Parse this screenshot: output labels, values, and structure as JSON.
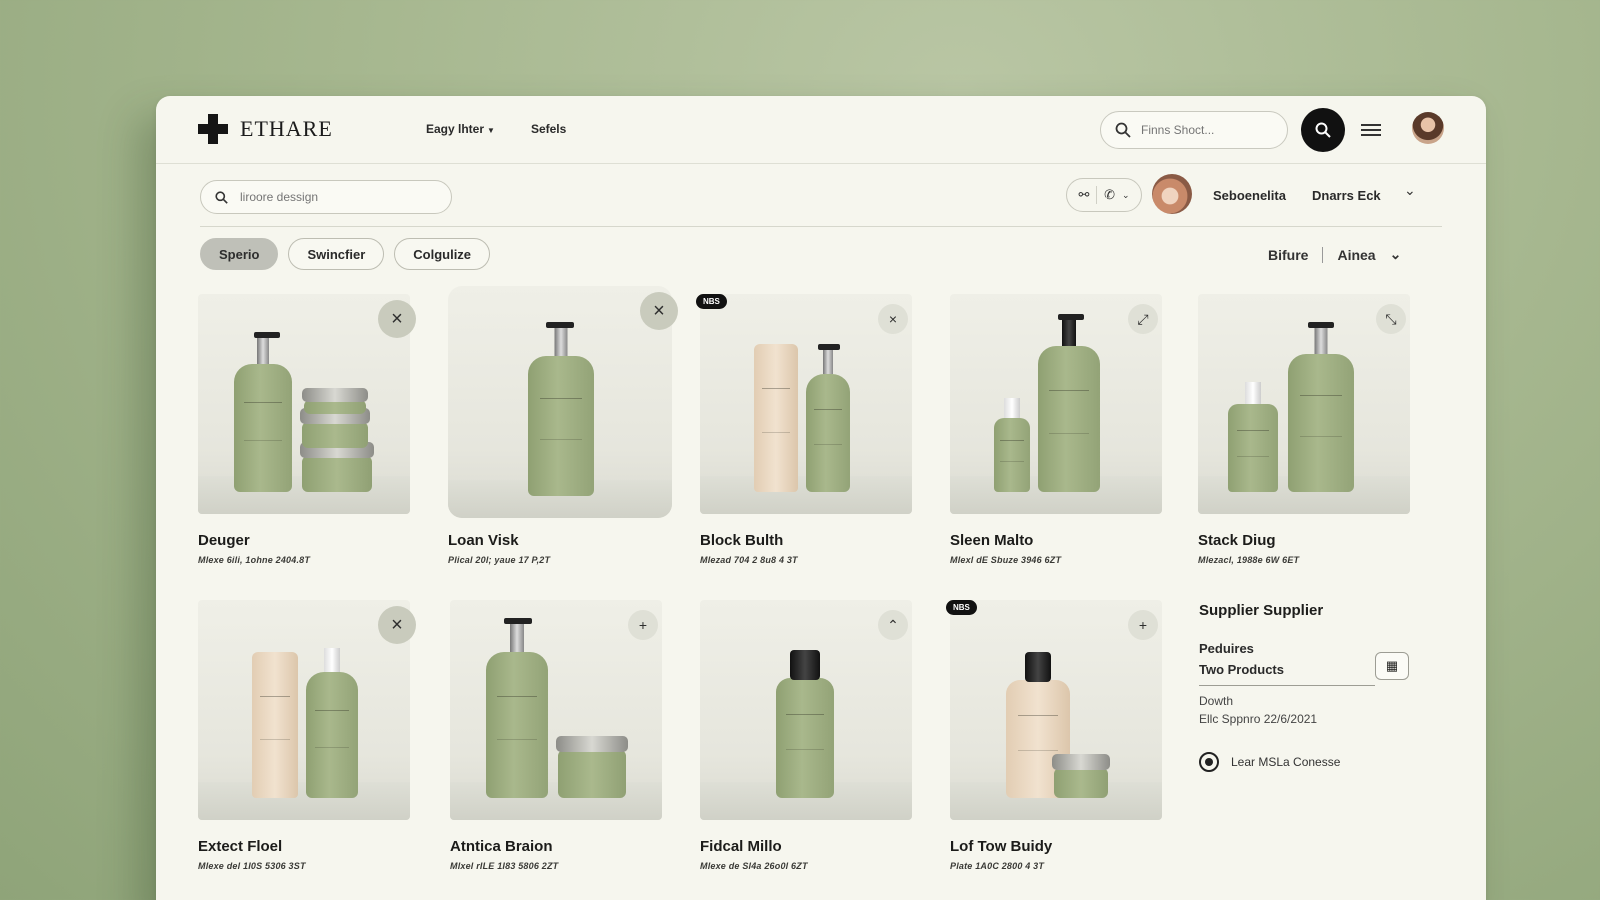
{
  "brand": {
    "name": "ETHARE"
  },
  "nav": {
    "item1": "Eagy lhter",
    "item2": "Sefels"
  },
  "top_search": {
    "placeholder": "Finns Shoct..."
  },
  "sub_search": {
    "placeholder": "liroore dessign"
  },
  "user": {
    "name1": "Seboenelita",
    "name2": "Dnarrs Eck"
  },
  "filters": {
    "chips": [
      "Sperio",
      "Swincfier",
      "Colgulize"
    ],
    "active_index": 0
  },
  "sort": {
    "label1": "Bifure",
    "label2": "Ainea"
  },
  "products": [
    {
      "name": "Deuger",
      "meta": "Mlexe 6ili, 1ohne 2404.8T",
      "action": "×"
    },
    {
      "name": "Loan Visk",
      "meta": "Plical 20l; yaue 17 P,2T",
      "action": "×"
    },
    {
      "name": "Block Bulth",
      "meta": "Mlezad 704 2 8u8 4 3T",
      "action": "×",
      "badge": "NBS"
    },
    {
      "name": "Sleen Malto",
      "meta": "Mlexl dE Sbuze 3946 6ZT",
      "action": "⤢"
    },
    {
      "name": "Stack Diug",
      "meta": "Mlezacl, 1988e 6W 6ET",
      "action": "⤡"
    },
    {
      "name": "Extect Floel",
      "meta": "Mlexe del 1I0S 5306 3ST",
      "action": "×"
    },
    {
      "name": "Atntica Braion",
      "meta": "Mlxel rILE 1I83 5806 2ZT",
      "action": "+"
    },
    {
      "name": "Fidcal Millo",
      "meta": "Mlexe de Sl4a 26o0l 6ZT",
      "action": "⌃"
    },
    {
      "name": "Lof Tow Buidy",
      "meta": "Plate 1A0C 2800 4 3T",
      "action": "+",
      "badge": "NBS"
    }
  ],
  "supplier": {
    "title": "Supplier Supplier",
    "label1": "Peduires",
    "label2": "Two Products",
    "label3": "Dowth",
    "label4": "Ellc Sppnro 22/6/2021",
    "link": "Lear MSLa Conesse"
  }
}
